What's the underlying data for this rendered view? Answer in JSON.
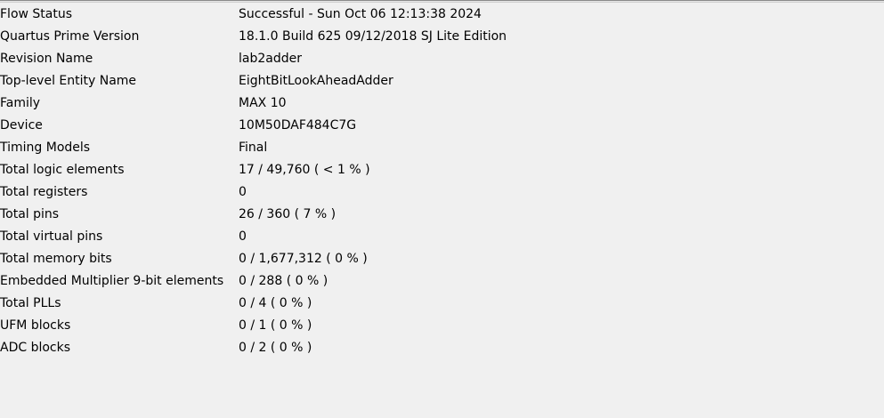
{
  "flow_summary": {
    "rows": [
      {
        "key": "Flow Status",
        "value": "Successful - Sun Oct 06 12:13:38 2024"
      },
      {
        "key": "Quartus Prime Version",
        "value": "18.1.0 Build 625 09/12/2018 SJ Lite Edition"
      },
      {
        "key": "Revision Name",
        "value": "lab2adder"
      },
      {
        "key": "Top-level Entity Name",
        "value": "EightBitLookAheadAdder"
      },
      {
        "key": "Family",
        "value": "MAX 10"
      },
      {
        "key": "Device",
        "value": "10M50DAF484C7G"
      },
      {
        "key": "Timing Models",
        "value": "Final"
      },
      {
        "key": "Total logic elements",
        "value": "17 / 49,760 ( < 1 % )"
      },
      {
        "key": "Total registers",
        "value": "0"
      },
      {
        "key": "Total pins",
        "value": "26 / 360 ( 7 % )"
      },
      {
        "key": "Total virtual pins",
        "value": "0"
      },
      {
        "key": "Total memory bits",
        "value": "0 / 1,677,312 ( 0 % )"
      },
      {
        "key": "Embedded Multiplier 9-bit elements",
        "value": "0 / 288 ( 0 % )"
      },
      {
        "key": "Total PLLs",
        "value": "0 / 4 ( 0 % )"
      },
      {
        "key": "UFM blocks",
        "value": "0 / 1 ( 0 % )"
      },
      {
        "key": "ADC blocks",
        "value": "0 / 2 ( 0 % )"
      }
    ]
  }
}
